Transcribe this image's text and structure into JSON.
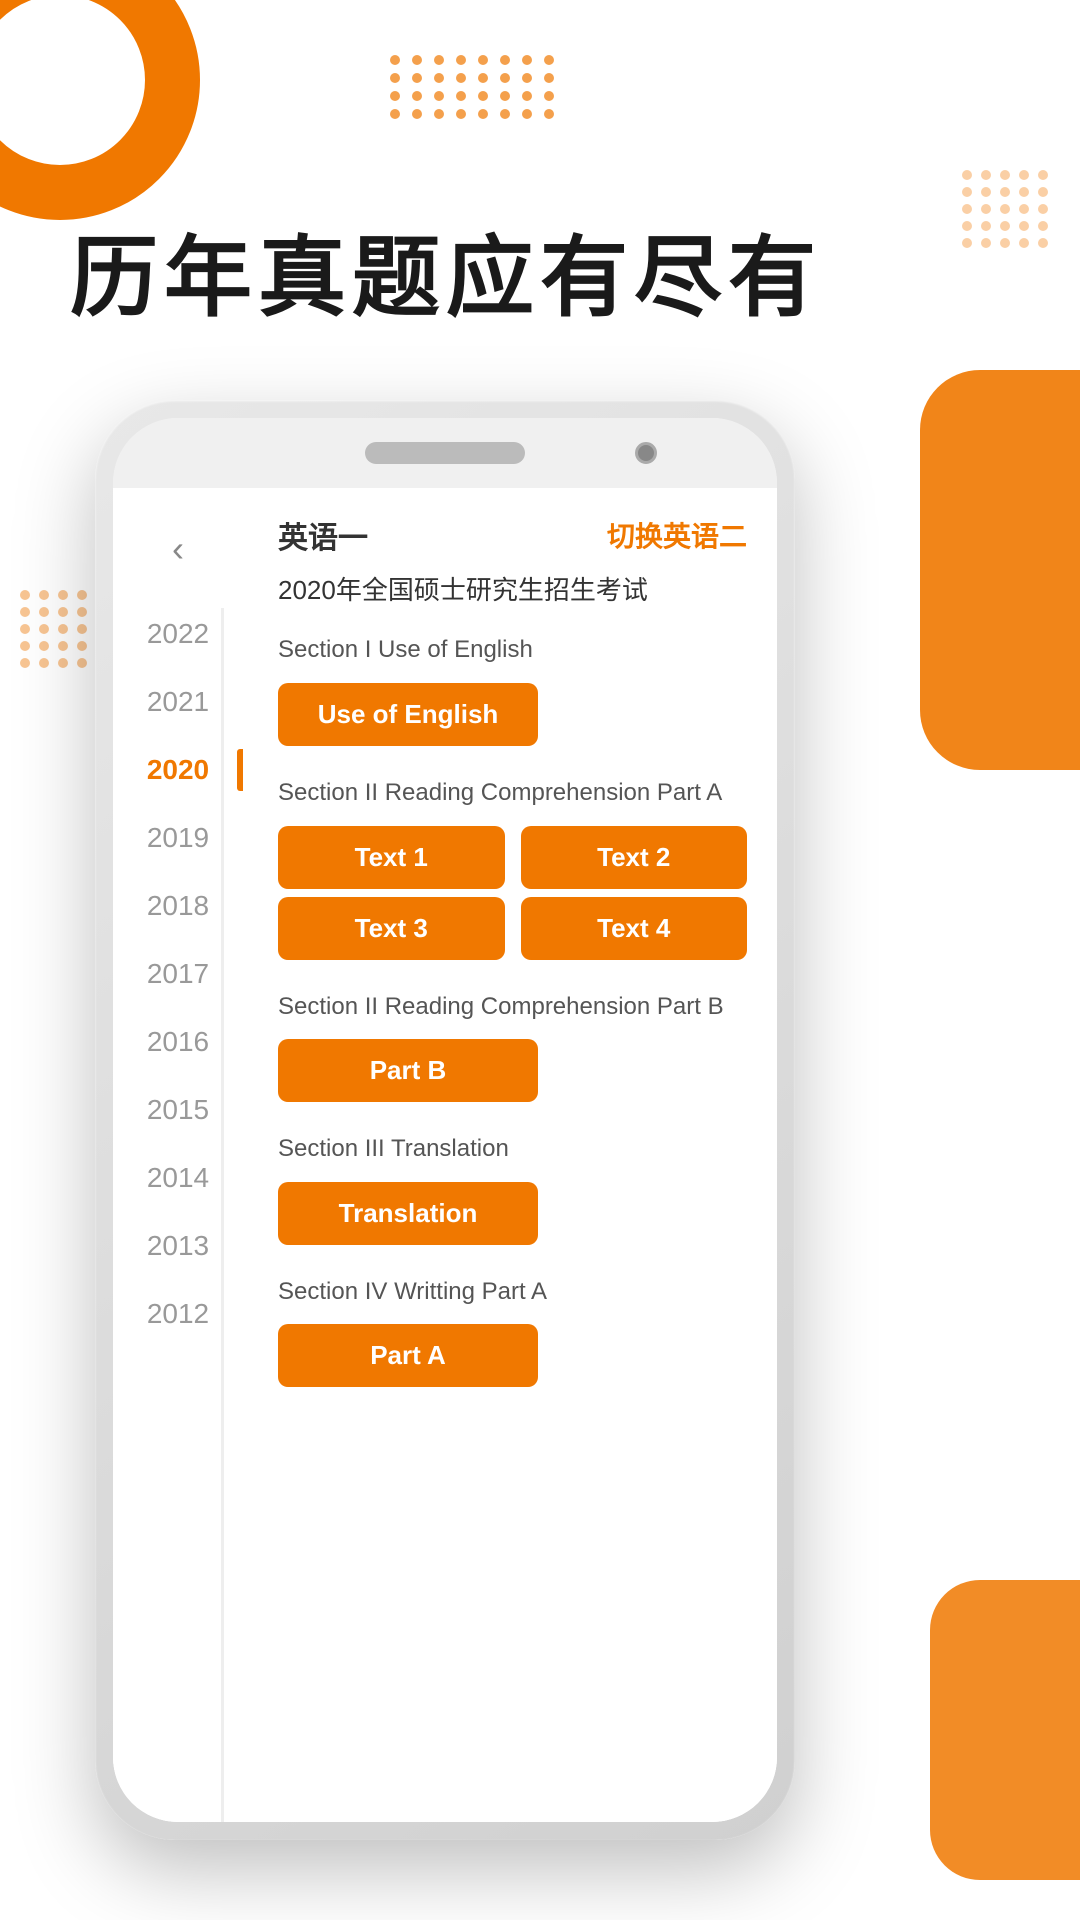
{
  "page": {
    "title": "历年真题应有尽有",
    "bg_dots_rows": 4,
    "bg_dots_cols": 8
  },
  "phone": {
    "speaker_aria": "speaker",
    "camera_aria": "camera"
  },
  "app": {
    "back_arrow": "‹",
    "exam_type": "英语一",
    "switch_label": "切换英语二",
    "exam_full_title": "2020年全国硕士研究生招生考试",
    "years": [
      {
        "year": "2022",
        "active": false
      },
      {
        "year": "2021",
        "active": false
      },
      {
        "year": "2020",
        "active": true
      },
      {
        "year": "2019",
        "active": false
      },
      {
        "year": "2018",
        "active": false
      },
      {
        "year": "2017",
        "active": false
      },
      {
        "year": "2016",
        "active": false
      },
      {
        "year": "2015",
        "active": false
      },
      {
        "year": "2014",
        "active": false
      },
      {
        "year": "2013",
        "active": false
      },
      {
        "year": "2012",
        "active": false
      }
    ],
    "sections": [
      {
        "id": "section1",
        "title": "Section I Use of English",
        "buttons": [
          {
            "label": "Use of English",
            "wide": true
          }
        ]
      },
      {
        "id": "section2",
        "title": "Section II Reading Comprehension Part A",
        "buttons": [
          {
            "label": "Text 1"
          },
          {
            "label": "Text 2"
          },
          {
            "label": "Text 3"
          },
          {
            "label": "Text 4"
          }
        ]
      },
      {
        "id": "section3",
        "title": "Section II Reading Comprehension Part B",
        "buttons": [
          {
            "label": "Part B",
            "wide": true
          }
        ]
      },
      {
        "id": "section4",
        "title": "Section III Translation",
        "buttons": [
          {
            "label": "Translation",
            "wide": true
          }
        ]
      },
      {
        "id": "section5",
        "title": "Section IV Writting Part A",
        "buttons": [
          {
            "label": "Part A",
            "wide": true
          }
        ]
      }
    ]
  },
  "colors": {
    "orange": "#F07800",
    "text_dark": "#1a1a1a",
    "text_mid": "#555",
    "text_light": "#999"
  }
}
